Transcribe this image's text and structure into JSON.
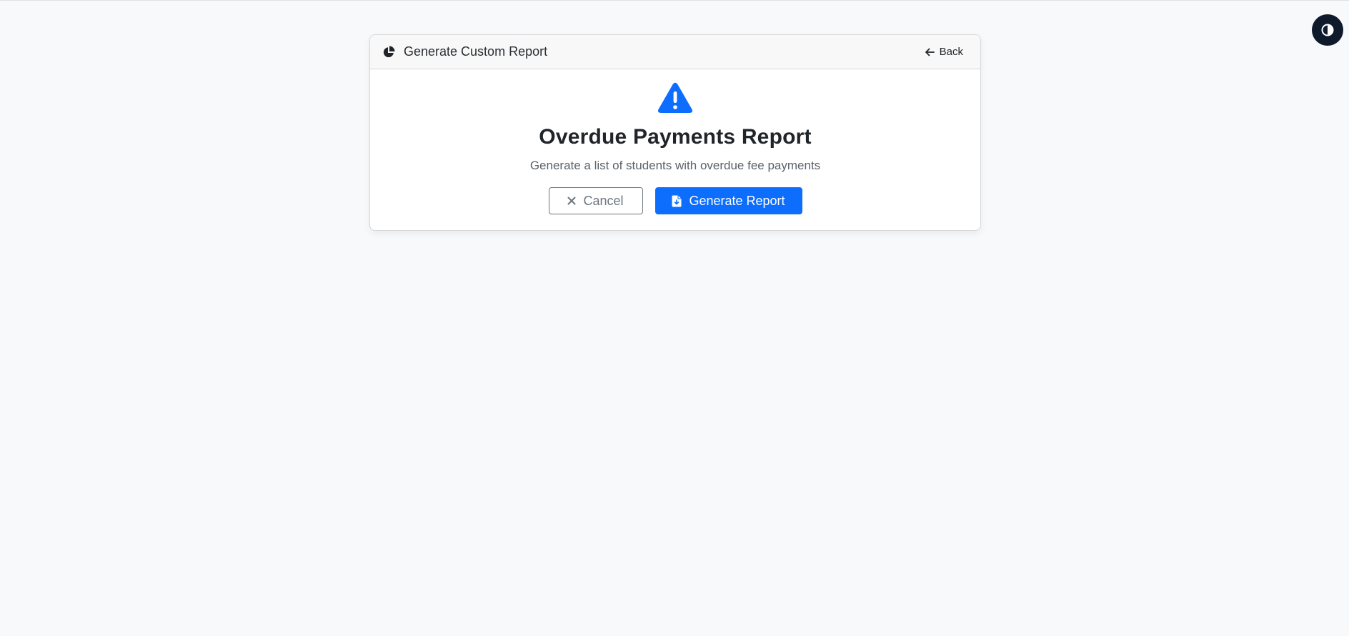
{
  "header": {
    "title": "Generate Custom Report",
    "title_icon": "chart-pie-icon",
    "back_label": "Back",
    "back_icon": "arrow-left-icon"
  },
  "report": {
    "icon": "warning-triangle-icon",
    "title": "Overdue Payments Report",
    "description": "Generate a list of students with overdue fee payments"
  },
  "actions": {
    "cancel_label": "Cancel",
    "cancel_icon": "close-icon",
    "generate_label": "Generate Report",
    "generate_icon": "file-download-icon"
  },
  "theme_toggle": {
    "icon": "contrast-icon"
  },
  "colors": {
    "primary": "#0d6efd",
    "background": "#f8f9fa",
    "toggle_background": "#0f1b2d",
    "secondary": "#6c757d"
  }
}
